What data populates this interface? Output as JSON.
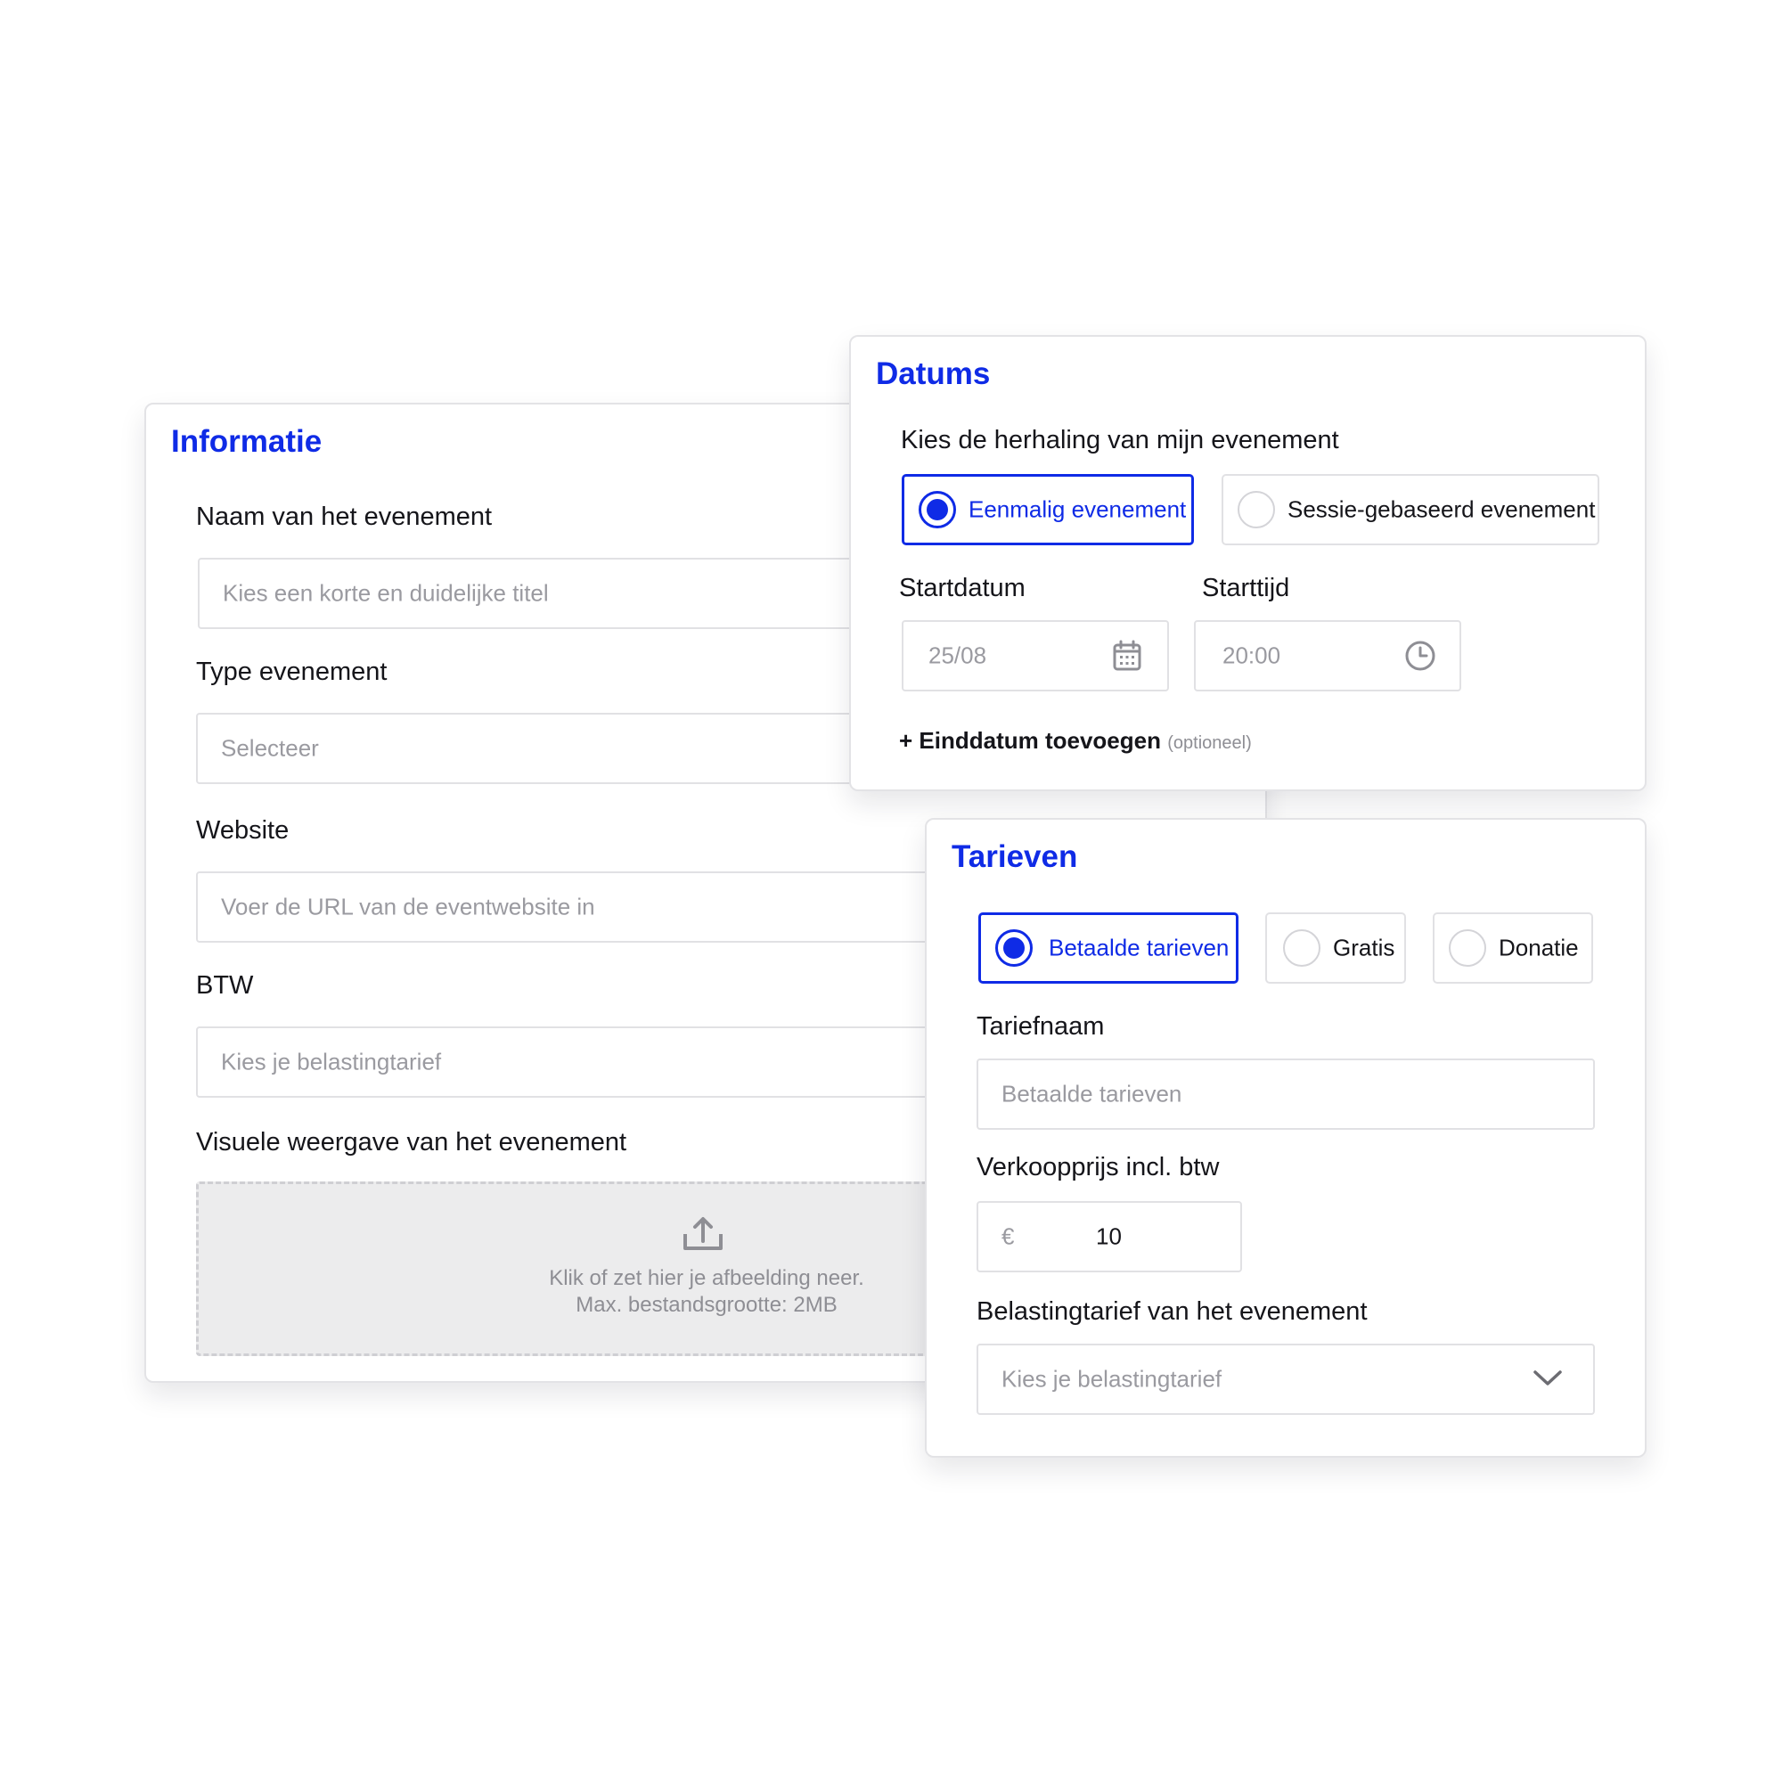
{
  "colors": {
    "accent": "#0f2be6",
    "border": "#e1e1e4",
    "placeholder": "#9a9aa0",
    "dropzone_bg": "#ececed"
  },
  "informatie": {
    "title": "Informatie",
    "name_label": "Naam van het evenement",
    "name_placeholder": "Kies een korte en duidelijke titel",
    "type_label": "Type evenement",
    "type_placeholder": "Selecteer",
    "website_label": "Website",
    "website_placeholder": "Voer de URL van de eventwebsite in",
    "btw_label": "BTW",
    "btw_placeholder": "Kies je belastingtarief",
    "visual_label": "Visuele weergave van het evenement",
    "upload_line1": "Klik of zet hier je afbeelding neer.",
    "upload_line2": "Max. bestandsgrootte: 2MB",
    "upload_icon": "upload-icon"
  },
  "datums": {
    "title": "Datums",
    "repeat_label": "Kies de herhaling van mijn evenement",
    "options": [
      {
        "label": "Eenmalig evenement",
        "selected": true
      },
      {
        "label": "Sessie-gebaseerd evenement",
        "selected": false
      }
    ],
    "start_date_label": "Startdatum",
    "start_date_value": "25/08",
    "start_date_icon": "calendar-icon",
    "start_time_label": "Starttijd",
    "start_time_value": "20:00",
    "start_time_icon": "clock-icon",
    "add_end_date": "+ Einddatum toevoegen",
    "optional": "(optioneel)"
  },
  "tarieven": {
    "title": "Tarieven",
    "options": [
      {
        "label": "Betaalde tarieven",
        "selected": true
      },
      {
        "label": "Gratis",
        "selected": false
      },
      {
        "label": "Donatie",
        "selected": false
      }
    ],
    "rate_name_label": "Tariefnaam",
    "rate_name_placeholder": "Betaalde tarieven",
    "price_label": "Verkoopprijs incl. btw",
    "currency": "€",
    "price_value": "10",
    "tax_label": "Belastingtarief van het evenement",
    "tax_placeholder": "Kies je belastingtarief",
    "tax_dropdown_icon": "chevron-down-icon"
  }
}
